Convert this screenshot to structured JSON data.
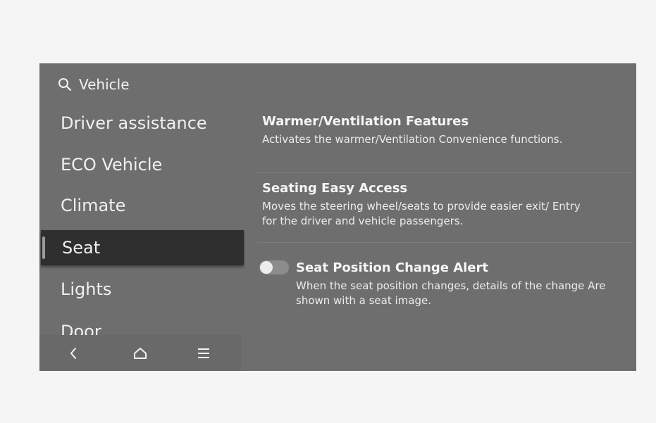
{
  "search": {
    "icon": "search-icon",
    "label": "Vehicle"
  },
  "sidebar": {
    "items": [
      {
        "label": "Driver assistance",
        "active": false
      },
      {
        "label": "ECO Vehicle",
        "active": false
      },
      {
        "label": "Climate",
        "active": false
      },
      {
        "label": "Seat",
        "active": true
      },
      {
        "label": "Lights",
        "active": false
      },
      {
        "label": "Door",
        "active": false
      }
    ]
  },
  "bottom_nav": {
    "back_icon": "back-icon",
    "home_icon": "home-icon",
    "menu_icon": "menu-icon"
  },
  "settings": [
    {
      "title": "Warmer/Ventilation Features",
      "description": "Activates the warmer/Ventilation Convenience functions.",
      "control": "chevron-right-icon"
    },
    {
      "title": "Seating Easy Access",
      "description": "Moves the steering wheel/seats to provide easier exit/ Entry for the driver and vehicle passengers.",
      "control": "chevron-right-icon"
    },
    {
      "title": "Seat Position Change Alert",
      "description": "When the seat position changes, details of the change Are shown with a seat image.",
      "control": "toggle",
      "enabled": false
    }
  ],
  "colors": {
    "screen_bg": "#6e6e6e",
    "active_item_bg": "#2f2f2f",
    "text": "#f2f2f2"
  }
}
